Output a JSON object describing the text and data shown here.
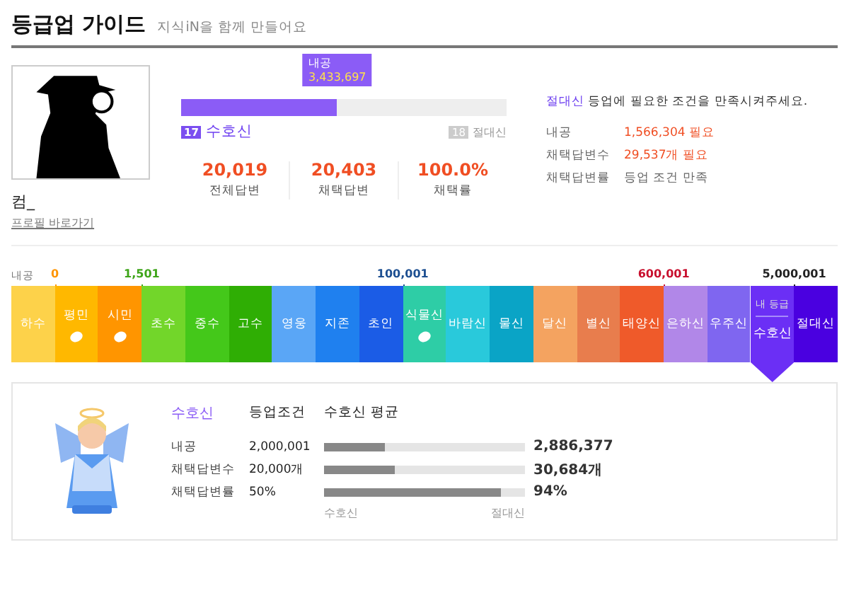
{
  "header": {
    "title": "등급업 가이드",
    "subtitle": "지식iN을 함께 만들어요"
  },
  "profile": {
    "name": "컴_",
    "link": "프로필 바로가기"
  },
  "progress": {
    "tooltip_label": "내공",
    "tooltip_value": "3,433,697",
    "level": 0.48,
    "current": {
      "number": "17",
      "name": "수호신"
    },
    "next": {
      "number": "18",
      "name": "절대신"
    }
  },
  "stats": [
    {
      "value": "20,019",
      "label": "전체답변"
    },
    {
      "value": "20,403",
      "label": "채택답변"
    },
    {
      "value": "100.0%",
      "label": "채택률"
    }
  ],
  "requirement": {
    "highlight": "절대신",
    "text": " 등업에 필요한 조건을 만족시켜주세요.",
    "rows": [
      {
        "label": "내공",
        "value": "1,566,304 필요",
        "kind": "need"
      },
      {
        "label": "채택답변수",
        "value": "29,537개 필요",
        "kind": "need"
      },
      {
        "label": "채택답변률",
        "value": "등업 조건 만족",
        "kind": "met"
      }
    ]
  },
  "tiers": {
    "axis_label": "내공",
    "my_badge": "내 등급",
    "items": [
      {
        "name": "하수",
        "color": "#fdd24a",
        "selected": false,
        "icon": false
      },
      {
        "name": "평민",
        "color": "#ffb800",
        "selected": false,
        "icon": true,
        "threshold": {
          "text": "0",
          "color": "#ff9500"
        }
      },
      {
        "name": "시민",
        "color": "#ff9500",
        "selected": false,
        "icon": true
      },
      {
        "name": "초수",
        "color": "#72d62a",
        "selected": false,
        "icon": false,
        "threshold": {
          "text": "1,501",
          "color": "#3fa51a"
        }
      },
      {
        "name": "중수",
        "color": "#44c81a",
        "selected": false,
        "icon": false
      },
      {
        "name": "고수",
        "color": "#2fae04",
        "selected": false,
        "icon": false
      },
      {
        "name": "영웅",
        "color": "#5aa6f6",
        "selected": false,
        "icon": false
      },
      {
        "name": "지존",
        "color": "#1f80ef",
        "selected": false,
        "icon": false
      },
      {
        "name": "초인",
        "color": "#1b5ce6",
        "selected": false,
        "icon": false
      },
      {
        "name": "식물신",
        "color": "#2ecda6",
        "selected": false,
        "icon": true,
        "threshold": {
          "text": "100,001",
          "color": "#1d4f91"
        }
      },
      {
        "name": "바람신",
        "color": "#29c9db",
        "selected": false,
        "icon": false
      },
      {
        "name": "물신",
        "color": "#0aa4c6",
        "selected": false,
        "icon": false
      },
      {
        "name": "달신",
        "color": "#f4a360",
        "selected": false,
        "icon": false
      },
      {
        "name": "별신",
        "color": "#e87d4d",
        "selected": false,
        "icon": false
      },
      {
        "name": "태양신",
        "color": "#ef5a2a",
        "selected": false,
        "icon": false
      },
      {
        "name": "은하신",
        "color": "#b187e8",
        "selected": false,
        "icon": false,
        "threshold": {
          "text": "600,001",
          "color": "#c8102e"
        }
      },
      {
        "name": "우주신",
        "color": "#7f66f0",
        "selected": false,
        "icon": false
      },
      {
        "name": "수호신",
        "color": "#6b2ff5",
        "selected": true,
        "icon": false
      },
      {
        "name": "절대신",
        "color": "#4a00e0",
        "selected": false,
        "icon": false,
        "threshold": {
          "text": "5,000,001",
          "color": "#222222"
        }
      }
    ]
  },
  "detail": {
    "tier": "수호신",
    "condition_header": "등업조건",
    "average_header": "수호신 평균",
    "rows": [
      {
        "label": "내공",
        "condition": "2,000,001",
        "level": 0.3,
        "average": "2,886,377"
      },
      {
        "label": "채택답변수",
        "condition": "20,000개",
        "level": 0.35,
        "average": "30,684개"
      },
      {
        "label": "채택답변률",
        "condition": "50%",
        "level": 0.88,
        "average": "94%"
      }
    ],
    "scale": [
      "수호신",
      "절대신"
    ]
  }
}
